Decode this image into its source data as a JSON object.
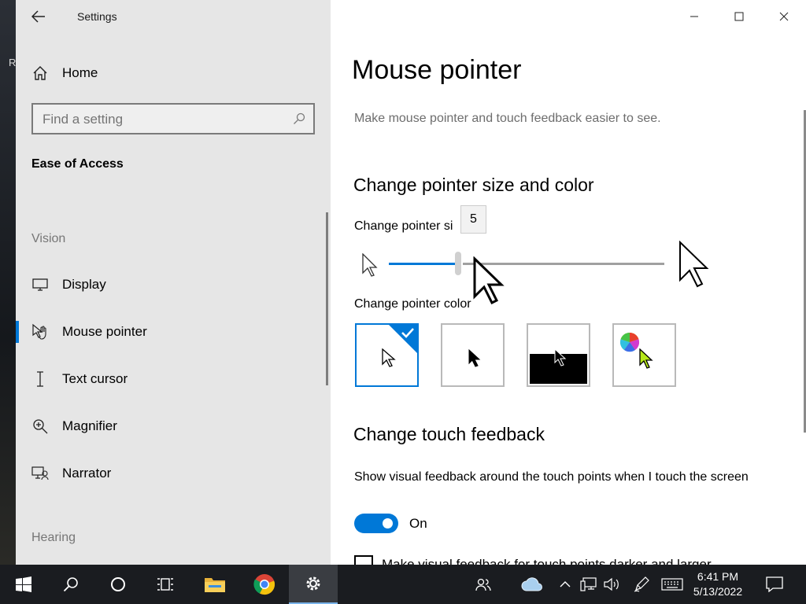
{
  "desktop": {
    "edge_text": "R"
  },
  "window": {
    "app_title": "Settings",
    "controls": {
      "minimize": "minimize-icon",
      "maximize": "maximize-icon",
      "close": "close-icon"
    }
  },
  "sidebar": {
    "home_label": "Home",
    "search_placeholder": "Find a setting",
    "section_title": "Ease of Access",
    "groups": {
      "vision": "Vision",
      "hearing": "Hearing"
    },
    "items": [
      {
        "label": "Display",
        "icon": "display-icon"
      },
      {
        "label": "Mouse pointer",
        "icon": "mouse-pointer-icon",
        "active": true
      },
      {
        "label": "Text cursor",
        "icon": "text-cursor-icon"
      },
      {
        "label": "Magnifier",
        "icon": "magnifier-icon"
      },
      {
        "label": "Narrator",
        "icon": "narrator-icon"
      }
    ]
  },
  "main": {
    "title": "Mouse pointer",
    "description": "Make mouse pointer and touch feedback easier to see.",
    "size_color_heading": "Change pointer size and color",
    "size_label": "Change pointer si",
    "size_value": "5",
    "size_fraction": 0.25,
    "color_label": "Change pointer color",
    "color_options": [
      {
        "name": "white",
        "selected": true
      },
      {
        "name": "black",
        "selected": false
      },
      {
        "name": "inverted",
        "selected": false
      },
      {
        "name": "custom",
        "selected": false
      }
    ],
    "touch_heading": "Change touch feedback",
    "touch_label": "Show visual feedback around the touch points when I touch the screen",
    "touch_toggle_state": "On",
    "darker_label": "Make visual feedback for touch points darker and larger"
  },
  "taskbar": {
    "time": "6:41 PM",
    "date": "5/13/2022",
    "accent": "#0078d7"
  }
}
